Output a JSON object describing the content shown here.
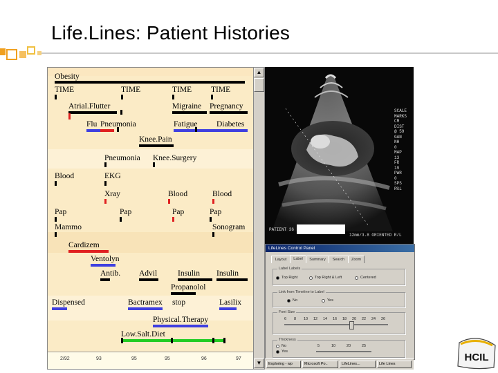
{
  "slide": {
    "title": "Life.Lines: Patient Histories"
  },
  "lifelines": {
    "labels": {
      "obesity": "Obesity",
      "time1": "TIME",
      "time2": "TIME",
      "time3": "TIME",
      "time4": "TIME",
      "atrial": "Atrial.Flutter",
      "migraine": "Migraine",
      "pregnancy": "Pregnancy",
      "flu": "Flu",
      "pneumonia": "Pneumonia",
      "fatigue": "Fatigue",
      "diabetes": "Diabetes",
      "kneepain": "Knee.Pain",
      "pneumonia2": "Pneumonia",
      "kneesurgery": "Knee.Surgery",
      "blood1": "Blood",
      "ekg": "EKG",
      "xray": "Xray",
      "blood2": "Blood",
      "blood3": "Blood",
      "pap1": "Pap",
      "pap2": "Pap",
      "pap3": "Pap",
      "pap4": "Pap",
      "mammo": "Mammo",
      "sonogram": "Sonogram",
      "cardizem": "Cardizem",
      "ventolyn": "Ventolyn",
      "antib": "Antib.",
      "advil": "Advil",
      "insulin1": "Insulin",
      "insulin2": "Insulin",
      "propanolol": "Propanolol",
      "dispensed": "Dispensed",
      "bactramex": "Bactramex",
      "stop": "stop",
      "lasilix": "Lasilix",
      "physical": "Physical.Therapy",
      "lowsalt": "Low.Salt.Diet"
    },
    "axis_ticks": [
      "2/92",
      "93",
      "95",
      "95",
      "96",
      "97"
    ]
  },
  "ultrasound": {
    "overlay_right": [
      "SCALE",
      "MARKS",
      "CM",
      "DIST",
      "@ 59",
      "GAN",
      "NH",
      "0",
      "MAP",
      "13",
      "FR",
      "19",
      "PWR",
      "0",
      "SPS",
      "R%L"
    ],
    "overlay_bottom": "PATIENT 36",
    "overlay_bottom_right": "12mm/3.8  ORIENTED R/L"
  },
  "control_panel": {
    "title": "LifeLines Control Panel",
    "tabs": [
      "Layout",
      "Label",
      "Summary",
      "Search",
      "Zoom"
    ],
    "group1_label": "Label Labels",
    "radio1": [
      "Top Right",
      "Top Right & Left",
      "Centered"
    ],
    "group2_label": "Link from Timeline to Label",
    "radio2": [
      "No",
      "Yes"
    ],
    "group3_label": "Font Size",
    "scale_numbers": [
      "6",
      "8",
      "10",
      "12",
      "14",
      "16",
      "18",
      "20",
      "22",
      "24",
      "26"
    ],
    "group4_label": "Thickness",
    "radio4": [
      "No",
      "Yes"
    ],
    "thickness_numbers": [
      "5",
      "10",
      "20",
      "25"
    ]
  },
  "taskbar": {
    "items": [
      "Exploring - wp",
      "Microsoft Po..",
      "LifeLines...",
      "Life Lines"
    ]
  },
  "logo": {
    "text": "HCIL"
  },
  "colors": {
    "lifelines_bg": "#fbebc6",
    "black_bar": "#000000",
    "blue_bar": "#3f3fe0",
    "red_bar": "#e02020",
    "green_bar": "#22cc22",
    "titlebar": "#0a246a"
  }
}
